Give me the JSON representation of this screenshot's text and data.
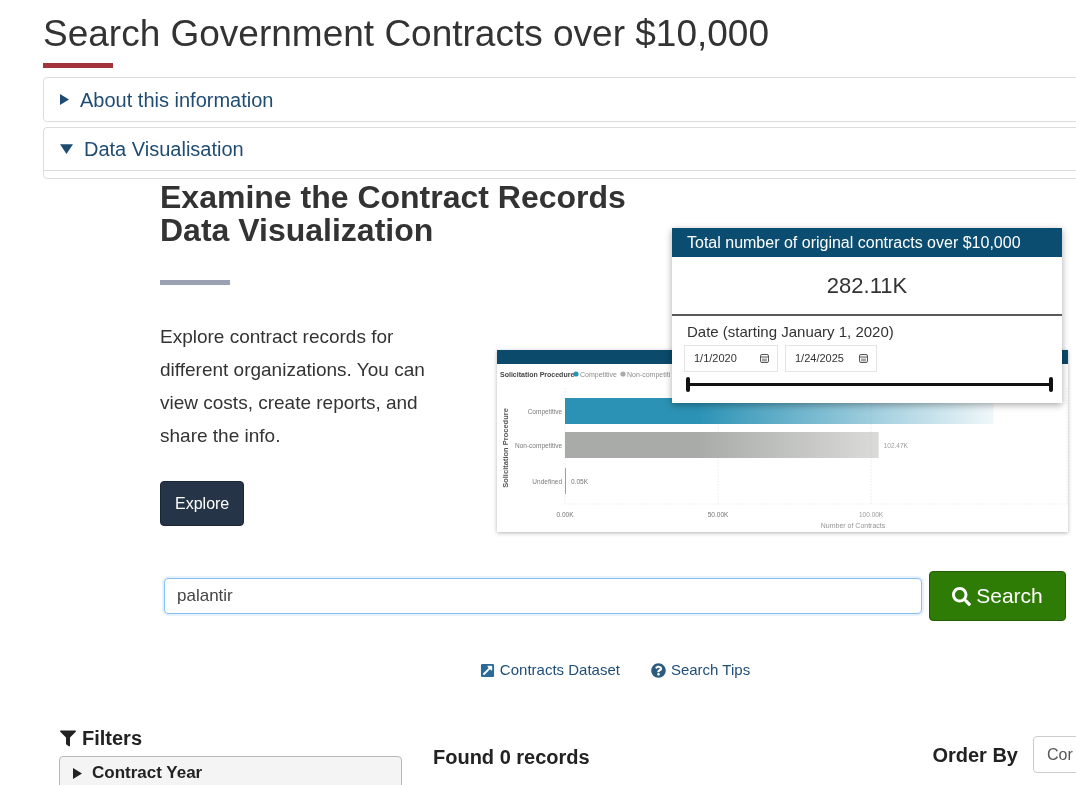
{
  "page": {
    "title": "Search Government Contracts over $10,000"
  },
  "accordions": [
    {
      "label": "About this information",
      "expanded": false
    },
    {
      "label": "Data Visualisation",
      "expanded": true
    }
  ],
  "visualization": {
    "heading": "Examine the Contract Records Data Visualization",
    "description": "Explore contract records for different organizations. You can view costs, create reports, and share the info.",
    "button": "Explore",
    "preview": {
      "card": {
        "title": "Total number of original contracts over $10,000",
        "value": "282.11K",
        "date_label": "Date (starting January 1, 2020)",
        "start_date": "1/1/2020",
        "end_date": "1/24/2025",
        "range_slider": {
          "level": 1
        }
      },
      "chart": {
        "legend": {
          "title": "Solicitation Procedure",
          "items": [
            {
              "label": "Competitive",
              "color": "#2b92b5"
            },
            {
              "label": "Non-competiti",
              "color": "#a9aba8"
            }
          ]
        },
        "chart_data": {
          "type": "bar",
          "orientation": "horizontal",
          "xlabel": "Number of Contracts",
          "ylabel": "Solicitation Procedure",
          "categories": [
            "Competitive",
            "Non-competitive",
            "Undefined"
          ],
          "series": [
            {
              "values": [
                140,
                102.47,
                0.05
              ]
            }
          ],
          "xlim": [
            0,
            164
          ],
          "xticks": [
            {
              "value": 0,
              "label": "0.00K"
            },
            {
              "value": 50,
              "label": "50.00K"
            },
            {
              "value": 100,
              "label": "100.00K"
            }
          ],
          "value_labels": [
            null,
            "102.47K",
            "0.05K"
          ]
        }
      }
    }
  },
  "search": {
    "value": "palantir",
    "button": "Search"
  },
  "links": [
    {
      "label": "Contracts Dataset",
      "kind": "external"
    },
    {
      "label": "Search Tips",
      "kind": "help"
    }
  ],
  "filters": {
    "title": "Filters",
    "groups": [
      {
        "label": "Contract Year",
        "expanded": false
      }
    ]
  },
  "results": {
    "summary": "Found 0 records"
  },
  "order_by": {
    "label": "Order By",
    "value": "Cor"
  }
}
